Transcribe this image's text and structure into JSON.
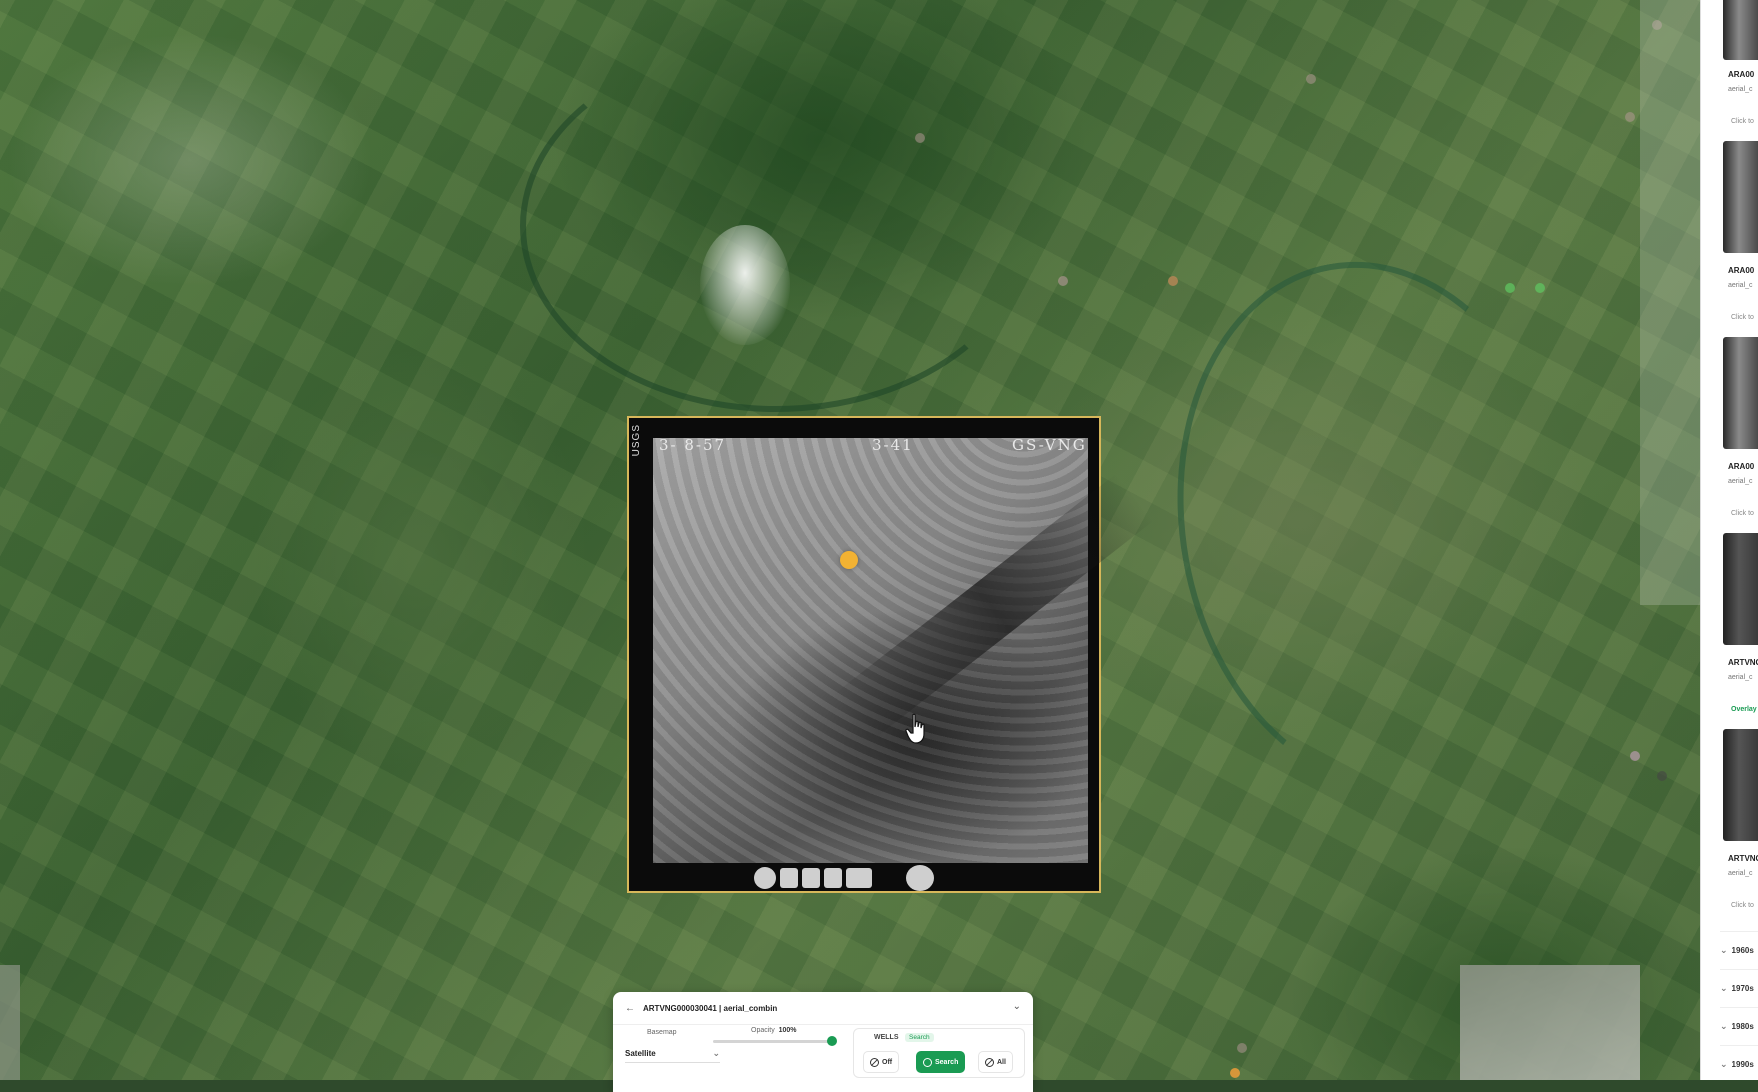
{
  "photo": {
    "label_left": "3- 8-57",
    "label_mid": "3-41",
    "label_right": "GS-VNG",
    "side_label": "USGS"
  },
  "results": [
    {
      "title": "ARA00",
      "sub": "aerial_c",
      "action": "Click to"
    },
    {
      "title": "ARA00",
      "sub": "aerial_c",
      "action": "Click to"
    },
    {
      "title": "ARA00",
      "sub": "aerial_c",
      "action": "Click to"
    },
    {
      "title": "ARTVNG",
      "sub": "aerial_c",
      "action": "Overlay"
    },
    {
      "title": "ARTVNG",
      "sub": "aerial_c",
      "action": "Click to"
    }
  ],
  "decades": [
    "1960s",
    "1970s",
    "1980s",
    "1990s"
  ],
  "control": {
    "layer_name": "ARTVNG000030041 | aerial_combin",
    "basemap_label": "Basemap",
    "basemap_value": "Satellite",
    "opacity_label": "Opacity",
    "opacity_value": "100%",
    "wells_title": "WELLS",
    "wells_mode": "Search",
    "btn_off": "Off",
    "btn_search": "Search",
    "btn_all": "All"
  },
  "colors": {
    "accent": "#1a9b53",
    "marker": "#f2b233",
    "photo_border": "#d7b75a"
  }
}
